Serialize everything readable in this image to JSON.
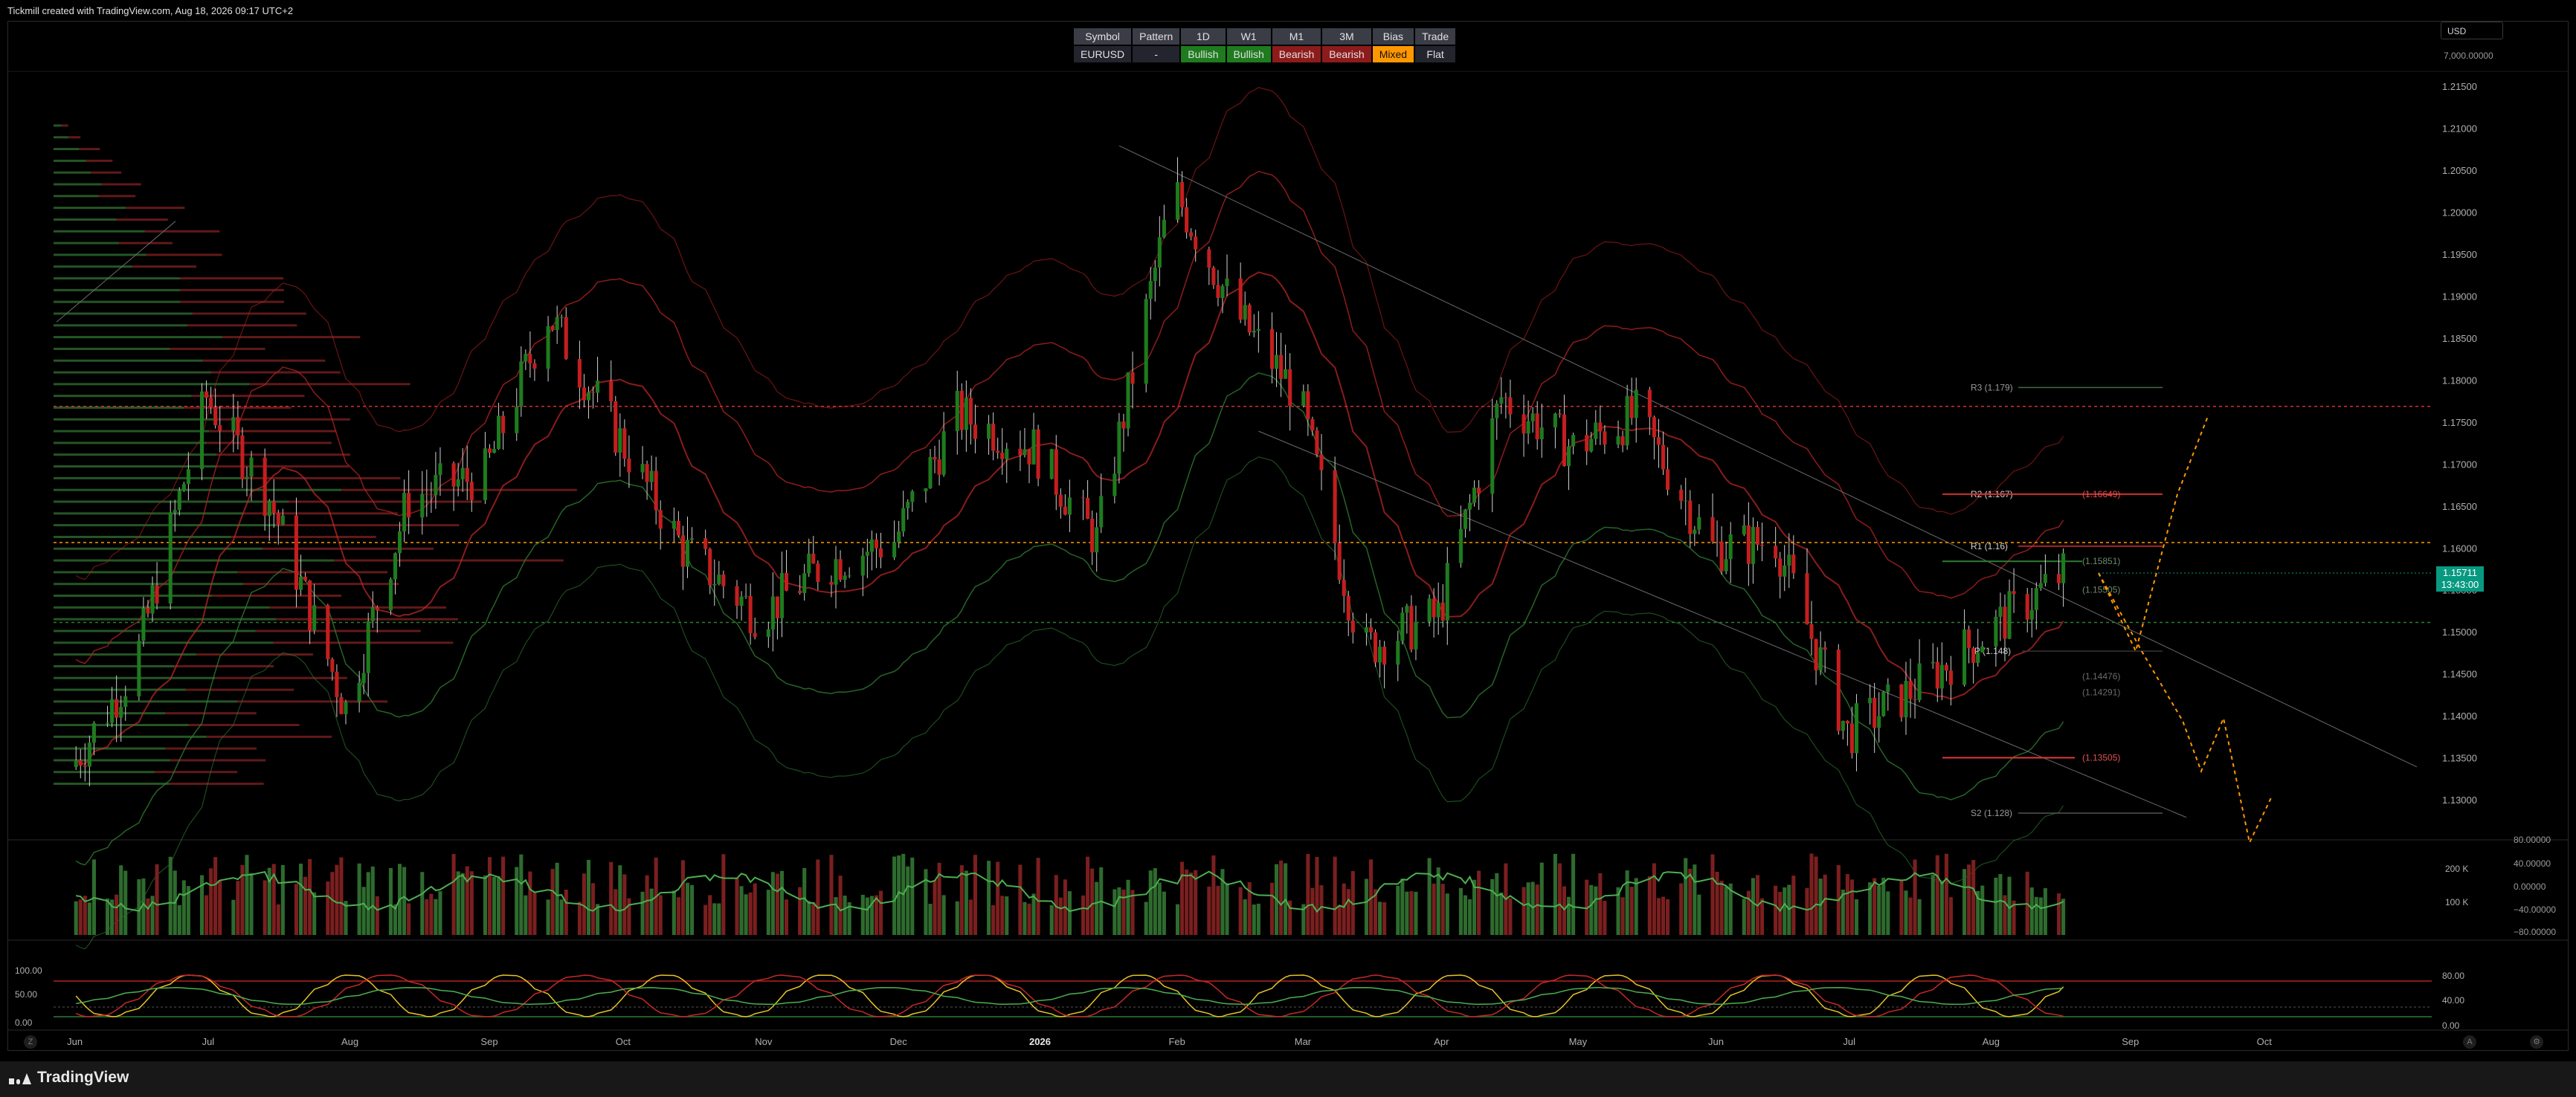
{
  "header": {
    "text": "Tickmill created with TradingView.com, Aug 18, 2026 09:17 UTC+2"
  },
  "bias_table": {
    "headers": [
      "Symbol",
      "Pattern",
      "1D",
      "W1",
      "M1",
      "3M",
      "Bias",
      "Trade"
    ],
    "values": [
      "EURUSD",
      "-",
      "Bullish",
      "Bullish",
      "Bearish",
      "Bearish",
      "Mixed",
      "Flat"
    ],
    "value_colors": [
      "#22252d",
      "#22252d",
      "#1e7b1e",
      "#1e7b1e",
      "#8e1b1b",
      "#8e1b1b",
      "#ff9800",
      "#22252d"
    ],
    "value_text_colors": [
      "#e0e0e0",
      "#e0e0e0",
      "#e0e0e0",
      "#e0e0e0",
      "#e0e0e0",
      "#e0e0e0",
      "#111111",
      "#e0e0e0"
    ]
  },
  "currency": "USD",
  "top_axis_value": "7,000.00000",
  "price_axis": {
    "labels": [
      "1.21500",
      "1.21000",
      "1.20500",
      "1.20000",
      "1.19500",
      "1.19000",
      "1.18500",
      "1.18000",
      "1.17500",
      "1.17000",
      "1.16500",
      "1.16000",
      "1.15500",
      "1.15000",
      "1.14500",
      "1.14000",
      "1.13500",
      "1.13000"
    ],
    "last_price": "1.15711",
    "countdown": "13:43:00"
  },
  "volume_axis": {
    "left_labels": [
      "200 K",
      "100 K"
    ],
    "right_labels": [
      "80.00000",
      "40.00000",
      "0.00000",
      "−40.00000",
      "−80.00000"
    ]
  },
  "osc_axis": {
    "left_labels": [
      "100.00",
      "50.00",
      "0.00"
    ],
    "right_labels": [
      "80.00",
      "40.00",
      "0.00"
    ]
  },
  "time_axis": {
    "labels": [
      "Jun",
      "Jul",
      "Aug",
      "Sep",
      "Oct",
      "Nov",
      "Dec",
      "2026",
      "Feb",
      "Mar",
      "Apr",
      "May",
      "Jun",
      "Jul",
      "Aug",
      "Sep",
      "Oct"
    ],
    "corner_left": "Z",
    "corner_right_a": "A",
    "corner_right_b": "⚙"
  },
  "pivot_labels": {
    "r3": "R3 (1.179)",
    "r2": "R2 (1.167)",
    "r2_alt": "(1.16649)",
    "r1": "R1 (1.16)",
    "p": "P (1.148)",
    "s2": "S2 (1.128)",
    "lvl_1": "(1.15851)",
    "lvl_2": "(1.15505)",
    "lvl_3": "(1.14476)",
    "lvl_4": "(1.14291)",
    "lvl_5": "(1.13505)"
  },
  "footer": {
    "brand": "TradingView"
  },
  "colors": {
    "bull": "#1e7b1e",
    "bear": "#c41e1e",
    "accent_orange": "#ff9800",
    "badge": "#089981"
  },
  "chart_data": {
    "type": "candlestick",
    "title": "",
    "symbol": "EURUSD",
    "x_range": [
      "2025-06",
      "2026-10"
    ],
    "ylim": [
      1.125,
      1.218
    ],
    "series_close_approx": [
      {
        "date": "2025-06-01",
        "value": 1.134
      },
      {
        "date": "2025-06-15",
        "value": 1.146
      },
      {
        "date": "2025-07-01",
        "value": 1.178
      },
      {
        "date": "2025-07-15",
        "value": 1.166
      },
      {
        "date": "2025-08-01",
        "value": 1.141
      },
      {
        "date": "2025-08-15",
        "value": 1.166
      },
      {
        "date": "2025-09-01",
        "value": 1.169
      },
      {
        "date": "2025-09-15",
        "value": 1.188
      },
      {
        "date": "2025-10-01",
        "value": 1.173
      },
      {
        "date": "2025-10-15",
        "value": 1.16
      },
      {
        "date": "2025-11-01",
        "value": 1.152
      },
      {
        "date": "2025-11-15",
        "value": 1.158
      },
      {
        "date": "2025-12-01",
        "value": 1.161
      },
      {
        "date": "2025-12-15",
        "value": 1.176
      },
      {
        "date": "2026-01-01",
        "value": 1.172
      },
      {
        "date": "2026-01-15",
        "value": 1.161
      },
      {
        "date": "2026-02-01",
        "value": 1.203
      },
      {
        "date": "2026-02-15",
        "value": 1.188
      },
      {
        "date": "2026-03-01",
        "value": 1.178
      },
      {
        "date": "2026-03-15",
        "value": 1.148
      },
      {
        "date": "2026-04-01",
        "value": 1.152
      },
      {
        "date": "2026-04-15",
        "value": 1.178
      },
      {
        "date": "2026-05-01",
        "value": 1.172
      },
      {
        "date": "2026-05-15",
        "value": 1.176
      },
      {
        "date": "2026-06-01",
        "value": 1.16
      },
      {
        "date": "2026-06-15",
        "value": 1.161
      },
      {
        "date": "2026-07-01",
        "value": 1.138
      },
      {
        "date": "2026-07-15",
        "value": 1.143
      },
      {
        "date": "2026-08-01",
        "value": 1.15
      },
      {
        "date": "2026-08-18",
        "value": 1.157
      }
    ],
    "horizontal_levels": [
      1.17695,
      1.16073,
      1.15122
    ],
    "last_price": 1.15711
  }
}
